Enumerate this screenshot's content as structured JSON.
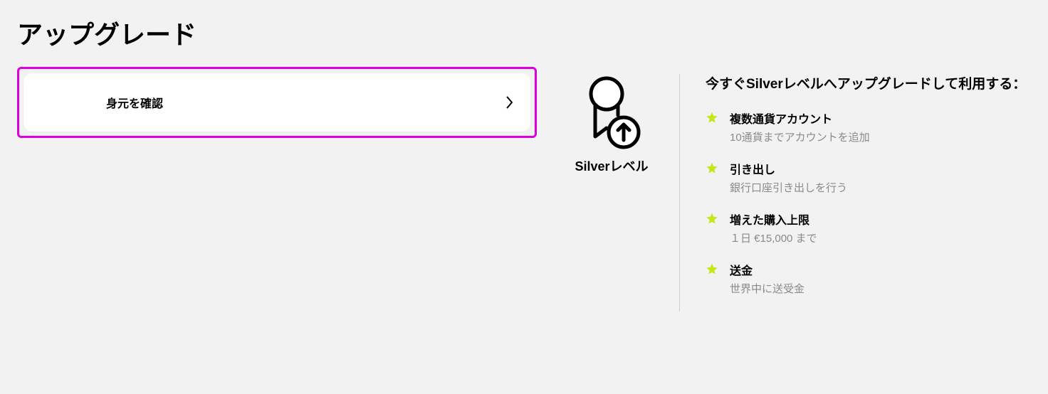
{
  "page_title": "アップグレード",
  "verify": {
    "label": "身元を確認"
  },
  "badge": {
    "label": "Silverレベル"
  },
  "features": {
    "heading": "今すぐSilverレベルへアップグレードして利用する：",
    "items": [
      {
        "title": "複数通貨アカウント",
        "desc": "10通貨までアカウントを追加"
      },
      {
        "title": "引き出し",
        "desc": "銀行口座引き出しを行う"
      },
      {
        "title": "増えた購入上限",
        "desc": "１日 €15,000 まで"
      },
      {
        "title": "送金",
        "desc": "世界中に送受金"
      }
    ]
  }
}
